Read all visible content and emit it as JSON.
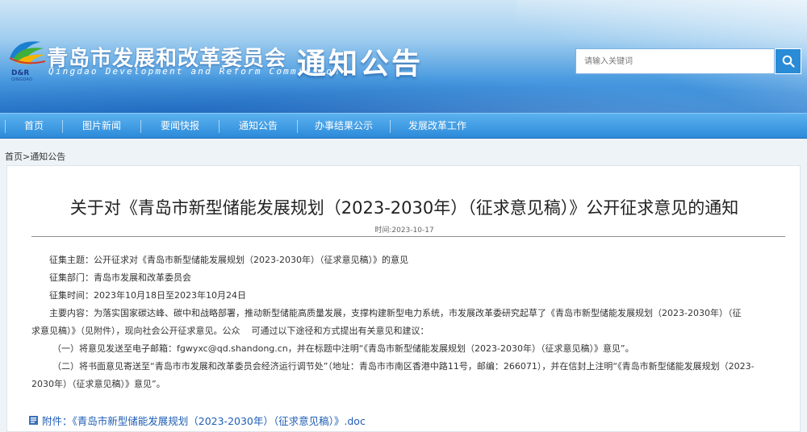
{
  "header": {
    "logo_text": "D&R",
    "logo_sub": "QINGDAO",
    "org_cn": "青岛市发展和改革委员会",
    "org_en": "Qingdao Development and Reform Commission",
    "section_title": "通知公告"
  },
  "search": {
    "placeholder": "请输入关键词",
    "button_icon": "search-icon"
  },
  "nav": {
    "items": [
      {
        "label": "首页"
      },
      {
        "label": "图片新闻"
      },
      {
        "label": "要闻快报"
      },
      {
        "label": "通知公告"
      },
      {
        "label": "办事结果公示"
      },
      {
        "label": "发展改革工作"
      }
    ]
  },
  "breadcrumb": {
    "home": "首页",
    "sep": ">",
    "current": "通知公告"
  },
  "article": {
    "title": "关于对《青岛市新型储能发展规划（2023-2030年）（征求意见稿）》公开征求意见的通知",
    "time": "时间:2023-10-17",
    "theme_label": "征集主题：",
    "theme_value": "公开征求对《青岛市新型储能发展规划（2023-2030年）（征求意见稿）》的意见",
    "dept_label": "征集部门：",
    "dept_value": "青岛市发展和改革委员会",
    "period_label": "征集时间：",
    "period_value": "2023年10月18日至2023年10月24日",
    "content_label": "主要内容：",
    "content_value_1": "为落实国家碳达峰、碳中和战略部署，推动新型储能高质量发展，支撑构建新型电力系统，市发展改革委研究起草了《青岛市新型储能发展规划（2023-2030年）（征",
    "content_value_2": "求意见稿）》（见附件），现向社会公开征求意见。公众    可通过以下途径和方式提出有关意见和建议：",
    "item_1": "（一）将意见发送至电子邮箱：fgwyxc@qd.shandong.cn，并在标题中注明“《青岛市新型储能发展规划（2023-2030年）（征求意见稿）》意见”。",
    "item_2_line1": "（二）将书面意见寄送至“青岛市市发展和改革委员会经济运行调节处”（地址：青岛市市南区香港中路11号，邮编：266071），并在信封上注明“《青岛市新型储能发展规划（2023-",
    "item_2_line2": "2030年）（征求意见稿）》意见”。",
    "attachment": "附件：《青岛市新型储能发展规划（2023-2030年）（征求意见稿）》.doc",
    "attachment_icon": "document-icon"
  },
  "colors": {
    "nav_bg": "#2c8ad9",
    "title_text": "#222222",
    "link": "#1e5db5"
  }
}
